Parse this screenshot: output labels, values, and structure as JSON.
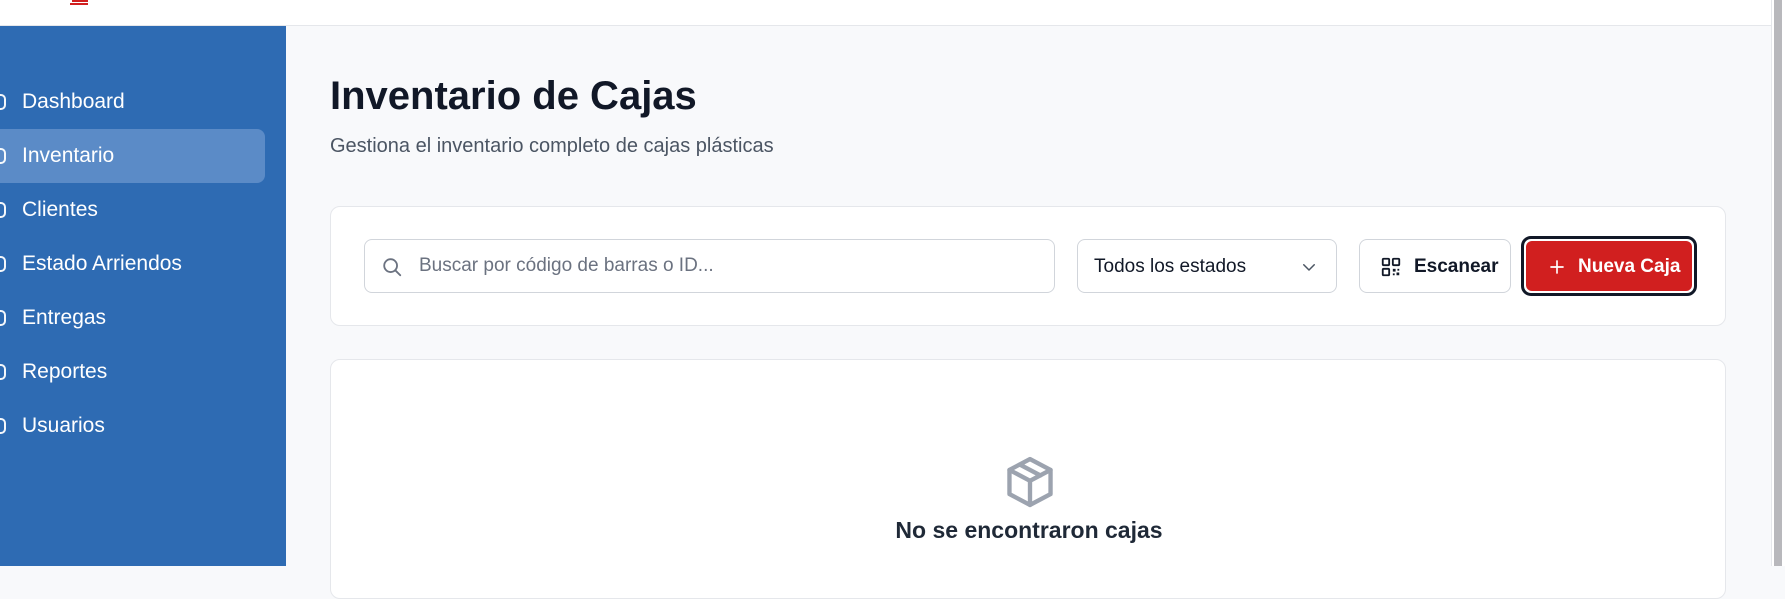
{
  "colors": {
    "sidebar_bg": "#2e6bb3",
    "sidebar_active": "#5b8bc7",
    "primary_button": "#d11f1f",
    "page_bg": "#f8f9fb"
  },
  "sidebar": {
    "items": [
      {
        "label": "Dashboard",
        "icon": "dashboard-icon",
        "active": false
      },
      {
        "label": "Inventario",
        "icon": "box-icon",
        "active": true
      },
      {
        "label": "Clientes",
        "icon": "users-icon",
        "active": false
      },
      {
        "label": "Estado Arriendos",
        "icon": "clipboard-icon",
        "active": false
      },
      {
        "label": "Entregas",
        "icon": "truck-icon",
        "active": false
      },
      {
        "label": "Reportes",
        "icon": "chart-icon",
        "active": false
      },
      {
        "label": "Usuarios",
        "icon": "settings-icon",
        "active": false
      }
    ]
  },
  "header": {
    "title": "Inventario de Cajas",
    "subtitle": "Gestiona el inventario completo de cajas plásticas"
  },
  "toolbar": {
    "search": {
      "placeholder": "Buscar por código de barras o ID...",
      "value": ""
    },
    "status_filter": {
      "selected": "Todos los estados"
    },
    "scan_label": "Escanear",
    "new_label": "Nueva Caja"
  },
  "empty_state": {
    "icon": "package-icon",
    "message": "No se encontraron cajas"
  }
}
